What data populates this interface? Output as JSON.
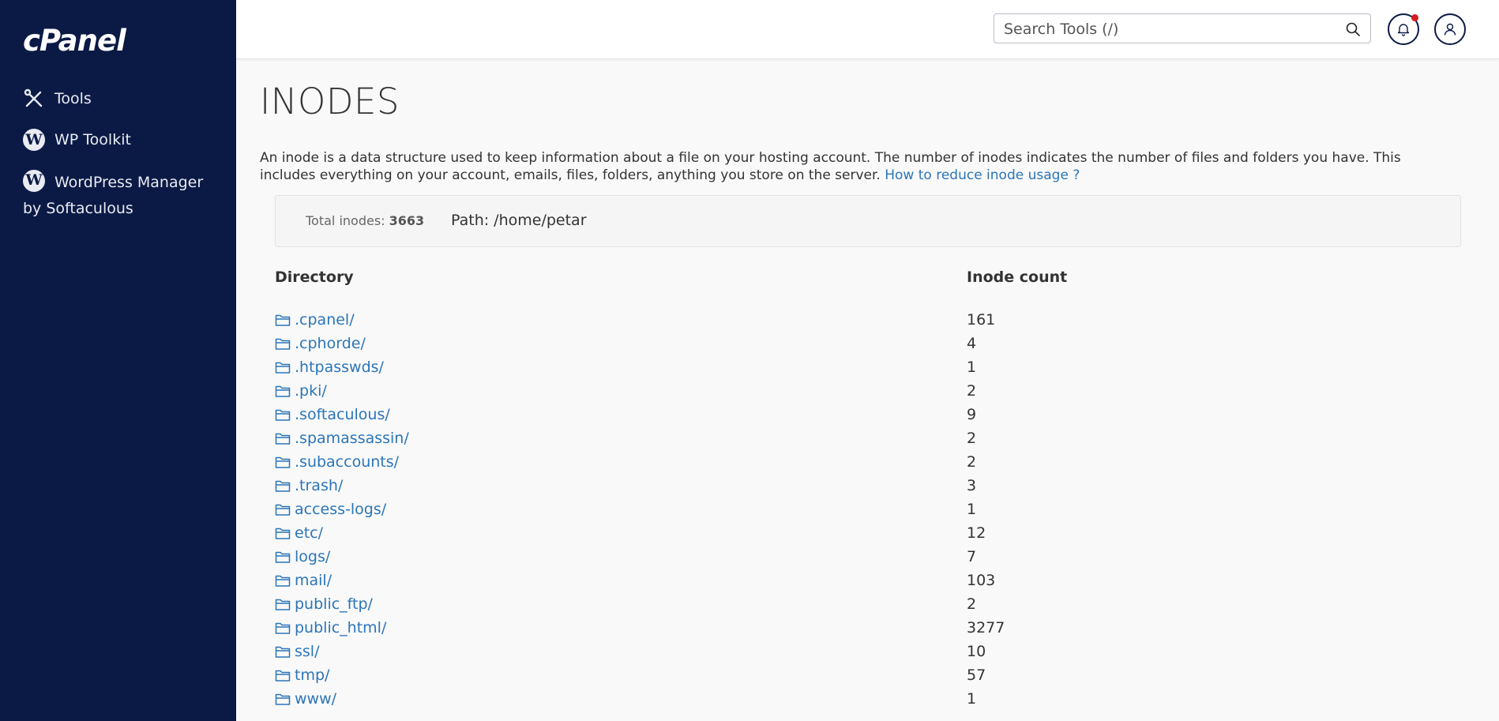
{
  "sidebar": {
    "logo": "cPanel",
    "items": [
      {
        "label": "Tools",
        "icon": "tools-icon"
      },
      {
        "label": "WP Toolkit",
        "icon": "wordpress-icon"
      },
      {
        "label": "WordPress Manager by Softaculous",
        "icon": "wordpress-icon"
      }
    ]
  },
  "header": {
    "search_placeholder": "Search Tools (/)",
    "notification_dot_color": "#d71d1d"
  },
  "page": {
    "title": "INODES",
    "description": "An inode is a data structure used to keep information about a file on your hosting account. The number of inodes indicates the number of files and folders you have. This includes everything on your account, emails, files, folders, anything you store on the server.",
    "help_link": "How to reduce inode usage ?",
    "total_label": "Total inodes:",
    "total_value": "3663",
    "path_label": "Path: /home/petar"
  },
  "table": {
    "headers": [
      "Directory",
      "Inode count"
    ],
    "rows": [
      {
        "dir": ".cpanel/",
        "count": "161"
      },
      {
        "dir": ".cphorde/",
        "count": "4"
      },
      {
        "dir": ".htpasswds/",
        "count": "1"
      },
      {
        "dir": ".pki/",
        "count": "2"
      },
      {
        "dir": ".softaculous/",
        "count": "9"
      },
      {
        "dir": ".spamassassin/",
        "count": "2"
      },
      {
        "dir": ".subaccounts/",
        "count": "2"
      },
      {
        "dir": ".trash/",
        "count": "3"
      },
      {
        "dir": "access-logs/",
        "count": "1"
      },
      {
        "dir": "etc/",
        "count": "12"
      },
      {
        "dir": "logs/",
        "count": "7"
      },
      {
        "dir": "mail/",
        "count": "103"
      },
      {
        "dir": "public_ftp/",
        "count": "2"
      },
      {
        "dir": "public_html/",
        "count": "3277"
      },
      {
        "dir": "ssl/",
        "count": "10"
      },
      {
        "dir": "tmp/",
        "count": "57"
      },
      {
        "dir": "www/",
        "count": "1"
      }
    ]
  },
  "colors": {
    "sidebar_bg": "#0b1a45",
    "link": "#2b75b8"
  }
}
